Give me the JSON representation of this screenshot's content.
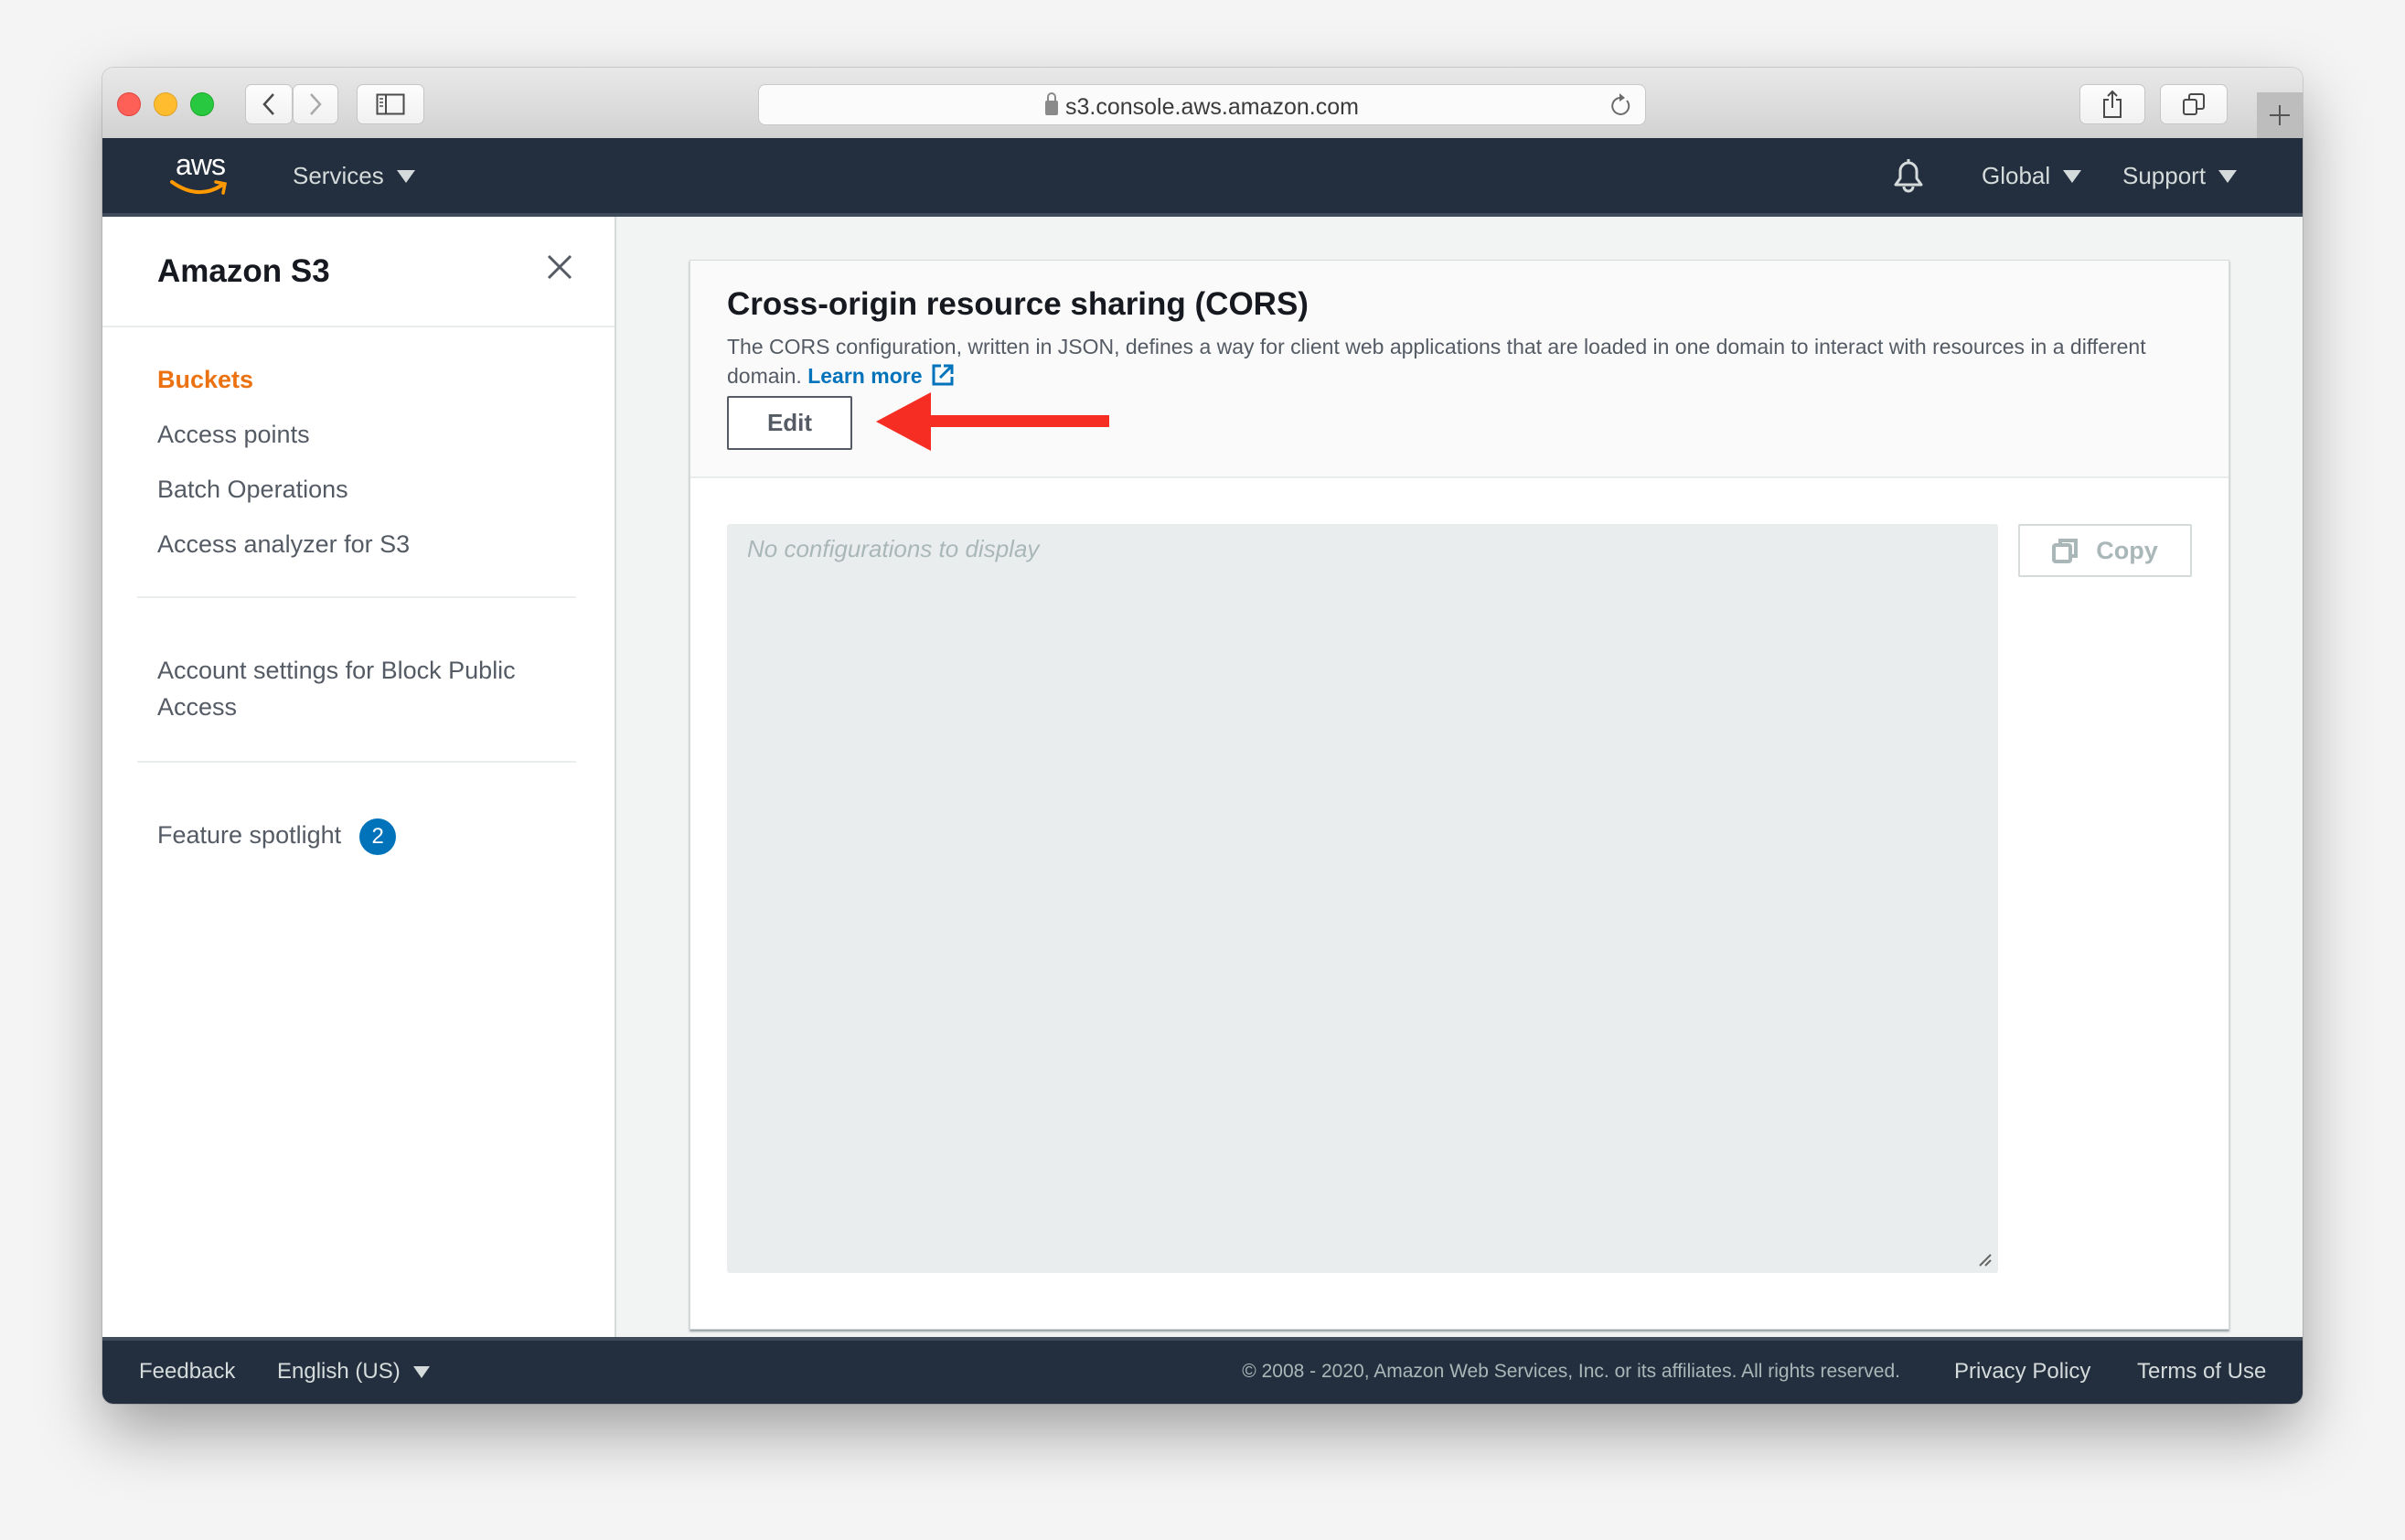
{
  "browser": {
    "url": "s3.console.aws.amazon.com"
  },
  "navbar": {
    "logo_text": "aws",
    "services_label": "Services",
    "region_label": "Global",
    "support_label": "Support"
  },
  "sidebar": {
    "title": "Amazon S3",
    "items": [
      {
        "label": "Buckets",
        "active": true
      },
      {
        "label": "Access points"
      },
      {
        "label": "Batch Operations"
      },
      {
        "label": "Access analyzer for S3"
      }
    ],
    "account_settings_label": "Account settings for Block Public Access",
    "feature_spotlight_label": "Feature spotlight",
    "feature_spotlight_count": "2"
  },
  "panel": {
    "title": "Cross-origin resource sharing (CORS)",
    "description": "The CORS configuration, written in JSON, defines a way for client web applications that are loaded in one domain to interact with resources in a different domain.",
    "learn_more_label": "Learn more",
    "edit_label": "Edit",
    "json_placeholder": "No configurations to display",
    "copy_label": "Copy"
  },
  "annotation": {
    "arrow_color": "#f52d22"
  },
  "footer": {
    "feedback_label": "Feedback",
    "language_label": "English (US)",
    "copyright": "© 2008 - 2020, Amazon Web Services, Inc. or its affiliates. All rights reserved.",
    "privacy_label": "Privacy Policy",
    "terms_label": "Terms of Use"
  }
}
